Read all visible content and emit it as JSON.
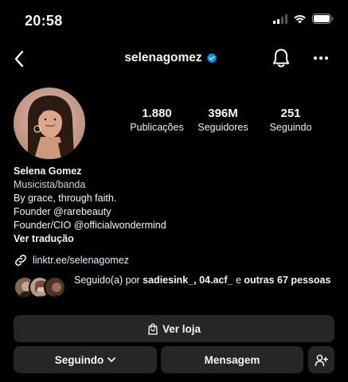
{
  "status_bar": {
    "time": "20:58"
  },
  "nav": {
    "username": "selenagomez"
  },
  "stats": [
    {
      "value": "1.880",
      "label": "Publicações"
    },
    {
      "value": "396M",
      "label": "Seguidores"
    },
    {
      "value": "251",
      "label": "Seguindo"
    }
  ],
  "bio": {
    "name": "Selena Gomez",
    "category": "Musicista/banda",
    "lines": [
      "By grace, through faith.",
      "Founder @rarebeauty",
      "Founder/CIO @officialwondermind"
    ],
    "translate": "Ver tradução"
  },
  "link": {
    "text": "linktr.ee/selenagomez"
  },
  "followed_by": {
    "prefix": "Seguido(a) por ",
    "user1": "sadiesink_",
    "sep": ", ",
    "user2": "04.acf_",
    "conj": " e ",
    "rest": "outras 67 pessoas"
  },
  "buttons": {
    "shop": "Ver loja",
    "following": "Seguindo",
    "message": "Mensagem"
  },
  "icons": {
    "back": "chevron-left-icon",
    "verified": "verified-badge-icon",
    "bell": "bell-icon",
    "more": "more-icon",
    "link": "link-icon",
    "shop": "shopping-bag-icon",
    "dropdown": "chevron-down-icon",
    "add_person": "add-person-icon"
  },
  "colors": {
    "background": "#000000",
    "button": "#262626",
    "verified": "#0095f6",
    "link": "#e0f1ff"
  }
}
